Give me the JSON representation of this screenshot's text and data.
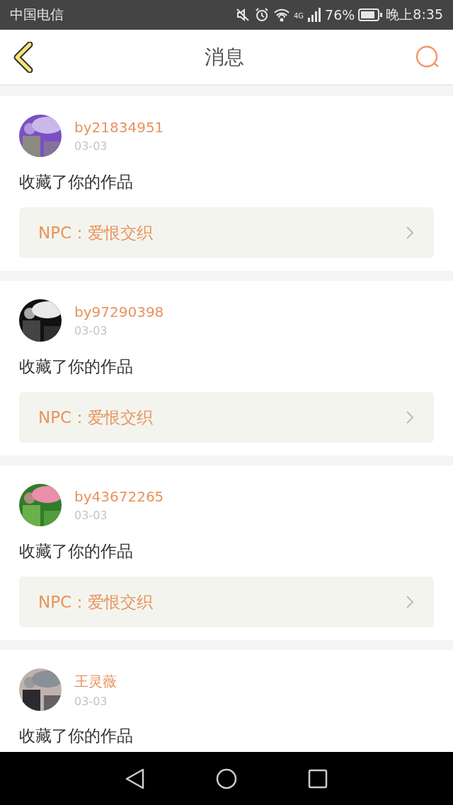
{
  "status_bar": {
    "carrier": "中国电信",
    "network": "4G",
    "battery": "76%",
    "time": "晚上8:35"
  },
  "header": {
    "title": "消息"
  },
  "messages": [
    {
      "user": "by21834951",
      "date": "03-03",
      "text": "收藏了你的作品",
      "link_prefix": "NPC：",
      "link_title": "爱恨交织"
    },
    {
      "user": "by97290398",
      "date": "03-03",
      "text": "收藏了你的作品",
      "link_prefix": "NPC：",
      "link_title": "爱恨交织"
    },
    {
      "user": "by43672265",
      "date": "03-03",
      "text": "收藏了你的作品",
      "link_prefix": "NPC：",
      "link_title": "爱恨交织"
    },
    {
      "user": "王灵薇",
      "date": "03-03",
      "text": "收藏了你的作品"
    }
  ]
}
